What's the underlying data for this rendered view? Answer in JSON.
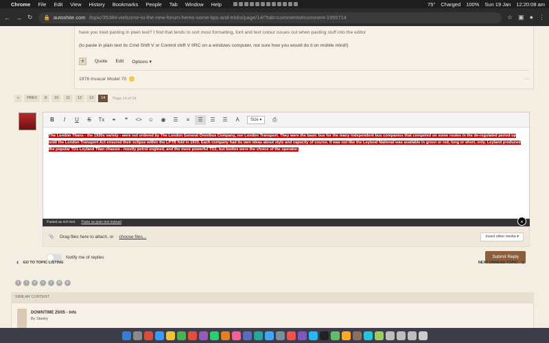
{
  "menubar": {
    "app": "Chrome",
    "items": [
      "File",
      "Edit",
      "View",
      "History",
      "Bookmarks",
      "People",
      "Tab",
      "Window",
      "Help"
    ],
    "status": [
      "75°",
      "Charged",
      "100%",
      "Sun 19 Jan",
      "12:20:08 am"
    ]
  },
  "browser": {
    "url_host": "autoshite.com",
    "url_path": "/topic/35384-welcome-to-the-new-forum-heres-some-tips-and-tricks/page/14/?tab=comments#comment-1955714"
  },
  "post": {
    "line1": "have you tried pasting in plain text? I find that tends to sort most formatting, font and text colour issues out when pasting stuff into the editor",
    "line2": "(to paste in plain text its Cmd Shift V or Control shift V IIRC on a windows computer, not sure how you would do it on mobile mind!)",
    "actions": [
      "Quote",
      "Edit",
      "Options"
    ],
    "signature": "1976 Invacar Model 70"
  },
  "pager": {
    "prev": "PREV",
    "pages": [
      "9",
      "10",
      "11",
      "12",
      "13",
      "14"
    ],
    "active": "14",
    "info": "Page 14 of 14"
  },
  "editor": {
    "size_label": "Size",
    "content": "The London Titans - the 1930s variety - were not ordered by The London General Omnibus Company, nor London Transport. They were the basic bus for the many independent bus companies that competed on some routes in the de-regulated period up until the London Transport Act ensured their eclipse within the LPTB fold in 1933. Each company had its own ideas about style and capacity of course. It was not like the Leyland National was available in green or red, long or short, only. Leyland produced the popular TD1 Leyland Titan chassis - mostly petrol engined, and the more powerful TD2, but bodies were the choice of the operator.",
    "notice": "Pasted as rich text.",
    "notice_link": "Paste as plain text instead"
  },
  "attach": {
    "drag_text": "Drag files here to attach, or",
    "choose": "choose files...",
    "other_media": "Insert other media"
  },
  "reply": {
    "notify": "Notify me of replies",
    "submit": "Submit Reply"
  },
  "nav": {
    "back": "GO TO TOPIC LISTING",
    "next": "NEXT UNREAD TOPIC"
  },
  "similar": {
    "heading": "SIMILAR CONTENT",
    "item_title": "DOWNTIME 25/05 - Info",
    "item_by": "By Stanky"
  },
  "colors": {
    "highlight": "#c00000",
    "submit": "#8b5e3c",
    "page_bg": "#f4ede2"
  }
}
